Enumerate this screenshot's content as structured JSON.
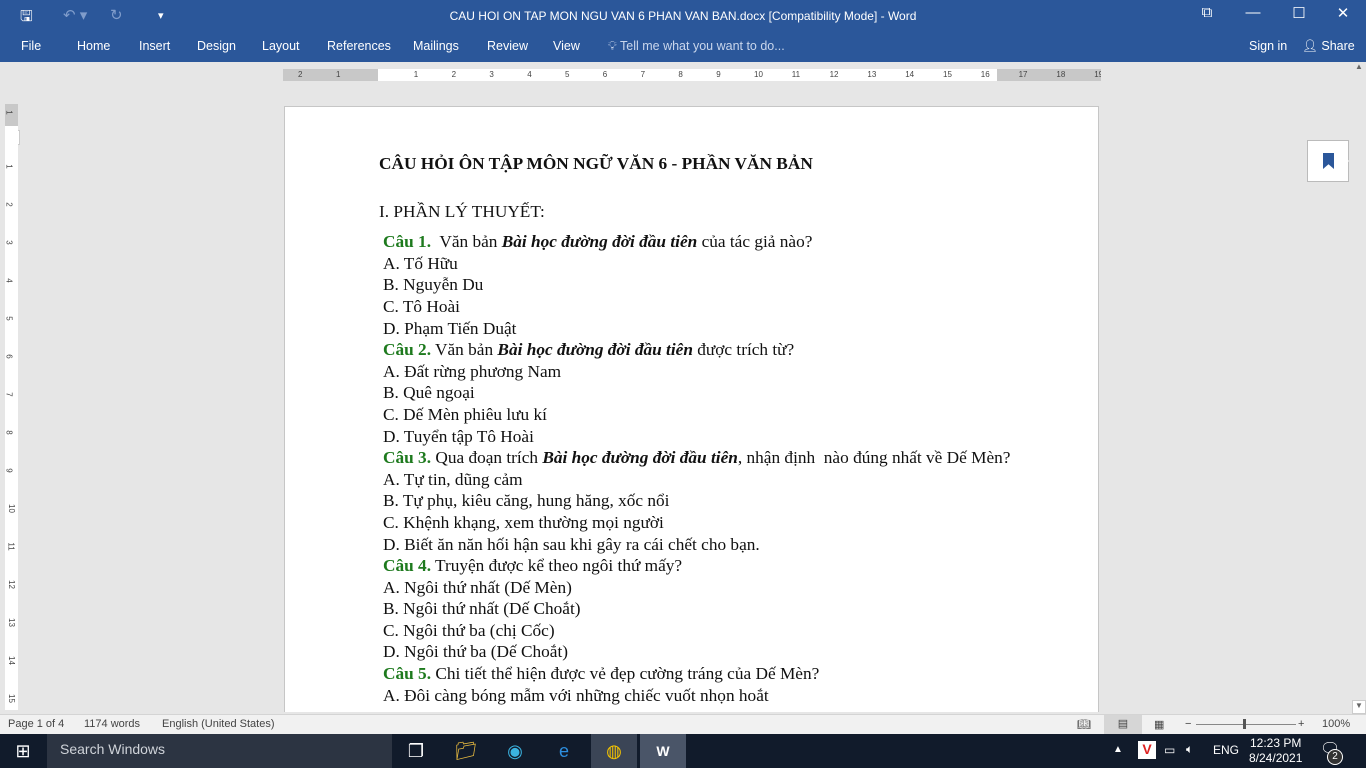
{
  "window": {
    "title": "CAU HOI ON TAP MON NGU VAN 6  PHAN VAN BAN.docx [Compatibility Mode] - Word"
  },
  "ribbon": {
    "tabs": [
      "File",
      "Home",
      "Insert",
      "Design",
      "Layout",
      "References",
      "Mailings",
      "Review",
      "View"
    ],
    "tell_me": "Tell me what you want to do...",
    "sign_in": "Sign in",
    "share": "Share"
  },
  "ruler": {
    "h_labels": [
      "2",
      "1",
      "1",
      "2",
      "3",
      "4",
      "5",
      "6",
      "7",
      "8",
      "9",
      "10",
      "11",
      "12",
      "13",
      "14",
      "15",
      "16",
      "17",
      "18",
      "19"
    ],
    "v_labels": [
      "1",
      "1",
      "2",
      "3",
      "4",
      "5",
      "6",
      "7",
      "8",
      "9",
      "10",
      "11",
      "12",
      "13",
      "14",
      "15"
    ]
  },
  "document": {
    "title": "CÂU HỎI ÔN TẬP MÔN NGỮ VĂN 6 - PHẦN VĂN BẢN",
    "section": "I. PHẦN LÝ THUYẾT:",
    "questions": [
      {
        "label": "Câu 1.",
        "pre": "  Văn bản ",
        "italic": "Bài học đường đời đầu tiên",
        "post": " của tác giả nào?",
        "options": [
          "A. Tố Hữu",
          "B. Nguyễn Du",
          "C. Tô Hoài",
          "D. Phạm Tiến Duật"
        ]
      },
      {
        "label": "Câu 2.",
        "pre": " Văn bản ",
        "italic": "Bài học đường đời đầu tiên",
        "post": " được trích từ?",
        "options": [
          "A. Đất rừng phương Nam",
          "B. Quê ngoại",
          "C. Dế Mèn phiêu lưu kí",
          "D. Tuyển tập Tô Hoài"
        ]
      },
      {
        "label": "Câu 3.",
        "pre": " Qua đoạn trích ",
        "italic": "Bài học đường đời đầu tiên",
        "post": ", nhận định  nào đúng nhất về Dế Mèn?",
        "options": [
          "A. Tự tin, dũng cảm",
          "B. Tự phụ, kiêu căng, hung hăng, xốc nổi",
          "C. Khệnh khạng, xem thường mọi người",
          "D. Biết ăn năn hối hận sau khi gây ra cái chết cho bạn."
        ]
      },
      {
        "label": "Câu 4.",
        "pre": " Truyện được kể theo ngôi thứ mấy?",
        "italic": "",
        "post": "",
        "options": [
          "A. Ngôi thứ nhất (Dế Mèn)",
          "B. Ngôi thứ nhất (Dế Choắt)",
          "C. Ngôi thứ ba (chị Cốc)",
          "D. Ngôi thứ ba (Dế Choắt)"
        ]
      },
      {
        "label": "Câu 5.",
        "pre": " Chi tiết thể hiện được vẻ đẹp cường tráng của Dế Mèn?",
        "italic": "",
        "post": "",
        "options": [
          "A. Đôi càng bóng mẫm với những chiếc vuốt nhọn hoắt"
        ]
      }
    ]
  },
  "status": {
    "page": "Page 1 of 4",
    "words": "1174 words",
    "language": "English (United States)",
    "zoom": "100%",
    "zoom_level": 100
  },
  "taskbar": {
    "search": "Search Windows",
    "language": "ENG",
    "time": "12:23 PM",
    "date": "8/24/2021",
    "notifications": "2"
  },
  "colors": {
    "brand": "#2b579a",
    "question_label": "#1e7a1e"
  }
}
